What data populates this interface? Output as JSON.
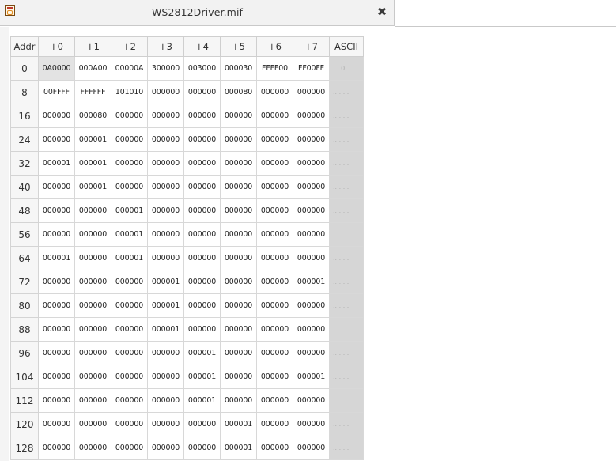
{
  "tab": {
    "title": "WS2812Driver.mif",
    "close_symbol": "✖"
  },
  "table": {
    "headers": [
      "Addr",
      "+0",
      "+1",
      "+2",
      "+3",
      "+4",
      "+5",
      "+6",
      "+7",
      "ASCII"
    ],
    "rows": [
      {
        "addr": "0",
        "cells": [
          "0A0000",
          "000A00",
          "00000A",
          "300000",
          "003000",
          "000030",
          "FFFF00",
          "FF00FF"
        ],
        "ascii": "....0.."
      },
      {
        "addr": "8",
        "cells": [
          "00FFFF",
          "FFFFFF",
          "101010",
          "000000",
          "000000",
          "000080",
          "000000",
          "000000"
        ],
        "ascii": "........"
      },
      {
        "addr": "16",
        "cells": [
          "000000",
          "000080",
          "000000",
          "000000",
          "000000",
          "000000",
          "000000",
          "000000"
        ],
        "ascii": "........"
      },
      {
        "addr": "24",
        "cells": [
          "000000",
          "000001",
          "000000",
          "000000",
          "000000",
          "000000",
          "000000",
          "000000"
        ],
        "ascii": "........"
      },
      {
        "addr": "32",
        "cells": [
          "000001",
          "000001",
          "000000",
          "000000",
          "000000",
          "000000",
          "000000",
          "000000"
        ],
        "ascii": "........"
      },
      {
        "addr": "40",
        "cells": [
          "000000",
          "000001",
          "000000",
          "000000",
          "000000",
          "000000",
          "000000",
          "000000"
        ],
        "ascii": "........"
      },
      {
        "addr": "48",
        "cells": [
          "000000",
          "000000",
          "000001",
          "000000",
          "000000",
          "000000",
          "000000",
          "000000"
        ],
        "ascii": "........"
      },
      {
        "addr": "56",
        "cells": [
          "000000",
          "000000",
          "000001",
          "000000",
          "000000",
          "000000",
          "000000",
          "000000"
        ],
        "ascii": "........"
      },
      {
        "addr": "64",
        "cells": [
          "000001",
          "000000",
          "000001",
          "000000",
          "000000",
          "000000",
          "000000",
          "000000"
        ],
        "ascii": "........"
      },
      {
        "addr": "72",
        "cells": [
          "000000",
          "000000",
          "000000",
          "000001",
          "000000",
          "000000",
          "000000",
          "000001"
        ],
        "ascii": "........"
      },
      {
        "addr": "80",
        "cells": [
          "000000",
          "000000",
          "000000",
          "000001",
          "000000",
          "000000",
          "000000",
          "000000"
        ],
        "ascii": "........"
      },
      {
        "addr": "88",
        "cells": [
          "000000",
          "000000",
          "000000",
          "000001",
          "000000",
          "000000",
          "000000",
          "000000"
        ],
        "ascii": "........"
      },
      {
        "addr": "96",
        "cells": [
          "000000",
          "000000",
          "000000",
          "000000",
          "000001",
          "000000",
          "000000",
          "000000"
        ],
        "ascii": "........"
      },
      {
        "addr": "104",
        "cells": [
          "000000",
          "000000",
          "000000",
          "000000",
          "000001",
          "000000",
          "000000",
          "000001"
        ],
        "ascii": "........"
      },
      {
        "addr": "112",
        "cells": [
          "000000",
          "000000",
          "000000",
          "000000",
          "000001",
          "000000",
          "000000",
          "000000"
        ],
        "ascii": "........"
      },
      {
        "addr": "120",
        "cells": [
          "000000",
          "000000",
          "000000",
          "000000",
          "000000",
          "000001",
          "000000",
          "000000"
        ],
        "ascii": "........"
      },
      {
        "addr": "128",
        "cells": [
          "000000",
          "000000",
          "000000",
          "000000",
          "000000",
          "000001",
          "000000",
          "000000"
        ],
        "ascii": "........"
      }
    ]
  }
}
